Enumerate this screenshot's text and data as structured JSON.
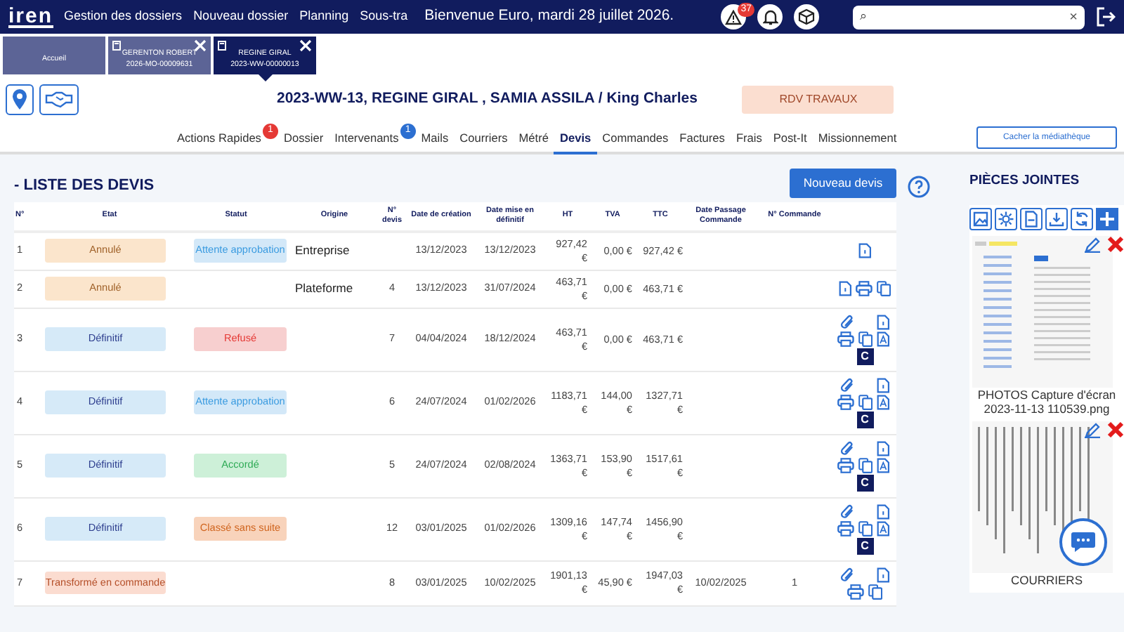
{
  "navbar": {
    "logo": "iren",
    "links": [
      "Gestion des dossiers",
      "Nouveau dossier",
      "Planning",
      "Sous-tra"
    ],
    "welcome": "Bienvenue Euro, mardi 28 juillet 2026.",
    "alert_count": "37",
    "search": {
      "placeholder": "⌕",
      "clear": "×"
    }
  },
  "dossier_tabs": [
    {
      "lines": [
        "Accueil"
      ],
      "selected": false,
      "closable": false
    },
    {
      "lines": [
        "GERENTON ROBERT",
        "2026-MO-00009631"
      ],
      "selected": false,
      "closable": true
    },
    {
      "lines": [
        "REGINE GIRAL",
        "2023-WW-00000013"
      ],
      "selected": true,
      "closable": true
    }
  ],
  "header": {
    "title": "2023-WW-13, REGINE GIRAL , SAMIA ASSILA / King Charles",
    "badge": "RDV TRAVAUX"
  },
  "tabs": [
    {
      "label": "Actions Rapides",
      "selected": false,
      "badge": {
        "text": "1",
        "color": "#e53935"
      }
    },
    {
      "label": "Dossier",
      "selected": false
    },
    {
      "label": "Intervenants",
      "selected": false,
      "badge": {
        "text": "1",
        "color": "#2c6fd1"
      }
    },
    {
      "label": "Mails",
      "selected": false
    },
    {
      "label": "Courriers",
      "selected": false
    },
    {
      "label": "Métré",
      "selected": false
    },
    {
      "label": "Devis",
      "selected": true
    },
    {
      "label": "Commandes",
      "selected": false
    },
    {
      "label": "Factures",
      "selected": false
    },
    {
      "label": "Frais",
      "selected": false
    },
    {
      "label": "Post-It",
      "selected": false
    },
    {
      "label": "Missionnement",
      "selected": false
    }
  ],
  "media_button": "Cacher la médiathèque",
  "devis": {
    "title": "- LISTE DES DEVIS",
    "new_button": "Nouveau devis",
    "columns": [
      "N°",
      "Etat",
      "Statut",
      "Origine",
      "N° devis",
      "Date de création",
      "Date mise en définitif",
      "HT",
      "TVA",
      "TTC",
      "Date Passage Commande",
      "N° Commande"
    ],
    "rows": [
      {
        "n": "1",
        "etat": {
          "label": "Annulé",
          "kind": "annule"
        },
        "statut": {
          "label": "Attente approbation",
          "kind": "attente"
        },
        "origine": "Entreprise",
        "date_creation": "13/12/2023",
        "date_definitif": "13/12/2023",
        "ht": "927,42 €",
        "tva": "0,00 €",
        "ttc": "927,42 €",
        "pdf": true
      },
      {
        "n": "2",
        "etat": {
          "label": "Annulé",
          "kind": "annule"
        },
        "origine": "Plateforme",
        "n_devis": "4",
        "date_creation": "13/12/2023",
        "date_definitif": "31/07/2024",
        "ht": "463,71 €",
        "tva": "0,00 €",
        "ttc": "463,71 €",
        "pdf": true,
        "print": true,
        "copy": true
      },
      {
        "n": "3",
        "etat": {
          "label": "Définitif",
          "kind": "definitif"
        },
        "statut": {
          "label": "Refusé",
          "kind": "refuse"
        },
        "n_devis": "7",
        "date_creation": "04/04/2024",
        "date_definitif": "18/12/2024",
        "ht": "463,71 €",
        "tva": "0,00 €",
        "ttc": "463,71 €",
        "attach": true,
        "pdf": true,
        "print": true,
        "copy": true,
        "sign": true,
        "commande_button": "C"
      },
      {
        "n": "4",
        "etat": {
          "label": "Définitif",
          "kind": "definitif"
        },
        "statut": {
          "label": "Attente approbation",
          "kind": "attente"
        },
        "n_devis": "6",
        "date_creation": "24/07/2024",
        "date_definitif": "01/02/2026",
        "ht": "1183,71 €",
        "tva": "144,00 €",
        "ttc": "1327,71 €",
        "attach": true,
        "pdf": true,
        "print": true,
        "copy": true,
        "sign": true,
        "commande_button": "C"
      },
      {
        "n": "5",
        "etat": {
          "label": "Définitif",
          "kind": "definitif"
        },
        "statut": {
          "label": "Accordé",
          "kind": "accorde"
        },
        "n_devis": "5",
        "date_creation": "24/07/2024",
        "date_definitif": "02/08/2024",
        "ht": "1363,71 €",
        "tva": "153,90 €",
        "ttc": "1517,61 €",
        "attach": true,
        "pdf": true,
        "print": true,
        "copy": true,
        "sign": true,
        "commande_button": "C"
      },
      {
        "n": "6",
        "etat": {
          "label": "Définitif",
          "kind": "definitif"
        },
        "statut": {
          "label": "Classé sans suite",
          "kind": "classe"
        },
        "n_devis": "12",
        "date_creation": "03/01/2025",
        "date_definitif": "01/02/2026",
        "ht": "1309,16 €",
        "tva": "147,74 €",
        "ttc": "1456,90 €",
        "attach": true,
        "pdf": true,
        "print": true,
        "copy": true,
        "sign": true,
        "commande_button": "C"
      },
      {
        "n": "7",
        "etat": {
          "label": "Transformé en commande",
          "kind": "transforme"
        },
        "n_devis": "8",
        "date_creation": "03/01/2025",
        "date_definitif": "10/02/2025",
        "ht": "1901,13 €",
        "tva": "45,90 €",
        "ttc": "1947,03 €",
        "date_commande": "10/02/2025",
        "n_commande": "1",
        "attach": true,
        "pdf": true,
        "print": true,
        "copy": true
      }
    ]
  },
  "attachments": {
    "title": "PIÈCES JOINTES",
    "items": [
      {
        "kind": "screenshot",
        "caption": "PHOTOS Capture d'écran 2023-11-13 110539.png"
      },
      {
        "kind": "document",
        "caption": "COURRIERS"
      }
    ]
  }
}
